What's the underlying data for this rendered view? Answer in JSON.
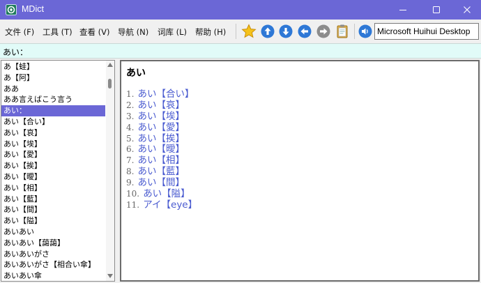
{
  "window": {
    "title": "MDict"
  },
  "menu": [
    "文件 (F)",
    "工具 (T)",
    "查看 (V)",
    "导航 (N)",
    "词库 (L)",
    "帮助 (H)"
  ],
  "toolbar": {
    "icons": [
      "favorite-star-icon",
      "up-arrow-icon",
      "down-arrow-icon",
      "back-arrow-icon",
      "forward-arrow-icon",
      "clipboard-icon",
      "speaker-icon"
    ],
    "font_value": "Microsoft Huihui Desktop"
  },
  "search": {
    "value": "あい："
  },
  "word_list": [
    "あ【蛙】",
    "あ【阿】",
    "ああ",
    "ああ言えばこう言う",
    "あい：",
    "あい【合い】",
    "あい【哀】",
    "あい【埃】",
    "あい【愛】",
    "あい【挨】",
    "あい【曖】",
    "あい【相】",
    "あい【藍】",
    "あい【間】",
    "あい【隘】",
    "あいあい",
    "あいあい【藹藹】",
    "あいあいがさ",
    "あいあいがさ【相合い傘】",
    "あいあい傘",
    "あいあん"
  ],
  "selected_index": 4,
  "definition": {
    "headword": "あい",
    "entries": [
      {
        "num": "1.",
        "text": "あい【合い】"
      },
      {
        "num": "2.",
        "text": "あい【哀】"
      },
      {
        "num": "3.",
        "text": "あい【埃】"
      },
      {
        "num": "4.",
        "text": "あい【愛】"
      },
      {
        "num": "5.",
        "text": "あい【挨】"
      },
      {
        "num": "6.",
        "text": "あい【曖】"
      },
      {
        "num": "7.",
        "text": "あい【相】"
      },
      {
        "num": "8.",
        "text": "あい【藍】"
      },
      {
        "num": "9.",
        "text": "あい【間】"
      },
      {
        "num": "10.",
        "text": "あい【隘】"
      },
      {
        "num": "11.",
        "text": "アイ【eye】"
      }
    ]
  },
  "colors": {
    "titlebar": "#6b67d6",
    "selection": "#6b67d6",
    "link": "#4a5bd0",
    "search_bg": "#e1fbf8"
  }
}
